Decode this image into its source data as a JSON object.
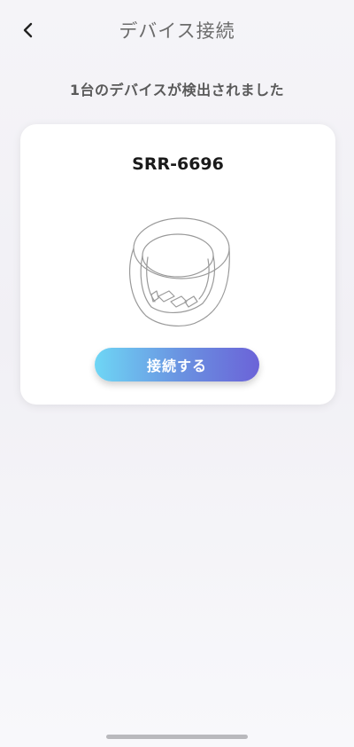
{
  "header": {
    "back_icon": "chevron-left-icon",
    "title": "デバイス接続"
  },
  "status": {
    "message": "1台のデバイスが検出されました"
  },
  "device_card": {
    "device_name": "SRR-6696",
    "image_icon": "smart-ring-icon",
    "connect_label": "接続する"
  },
  "colors": {
    "button_gradient_start": "#6ed6f5",
    "button_gradient_end": "#6b63d8",
    "title_text": "#6b6b6b",
    "card_bg": "#ffffff"
  }
}
